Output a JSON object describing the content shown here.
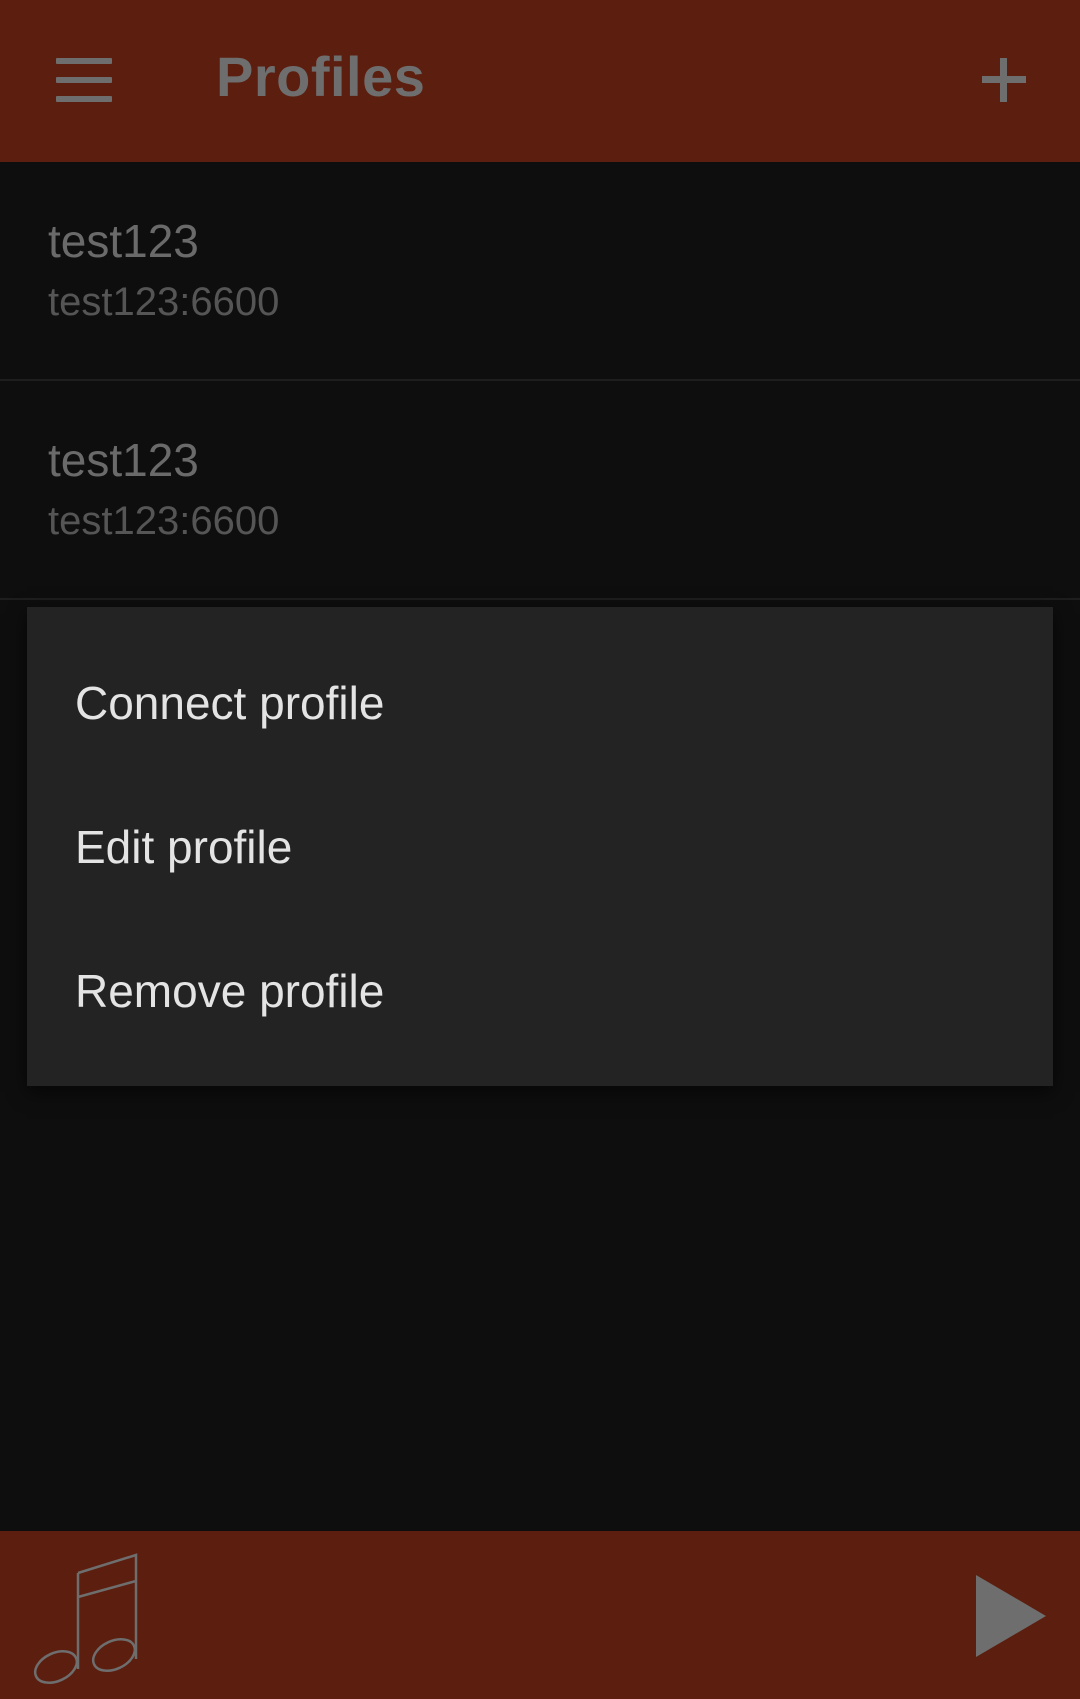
{
  "app_bar": {
    "title": "Profiles",
    "menu_icon": "hamburger-menu-icon",
    "add_icon": "plus-icon",
    "background": "#5c1e0e"
  },
  "profiles": [
    {
      "name": "test123",
      "host": "test123:6600"
    },
    {
      "name": "test123",
      "host": "test123:6600"
    }
  ],
  "context_menu": {
    "items": [
      {
        "label": "Connect profile"
      },
      {
        "label": "Edit profile"
      },
      {
        "label": "Remove profile"
      }
    ]
  },
  "bottom_bar": {
    "album_icon": "music-note-icon",
    "play_icon": "play-icon",
    "background": "#5c1e0e"
  }
}
